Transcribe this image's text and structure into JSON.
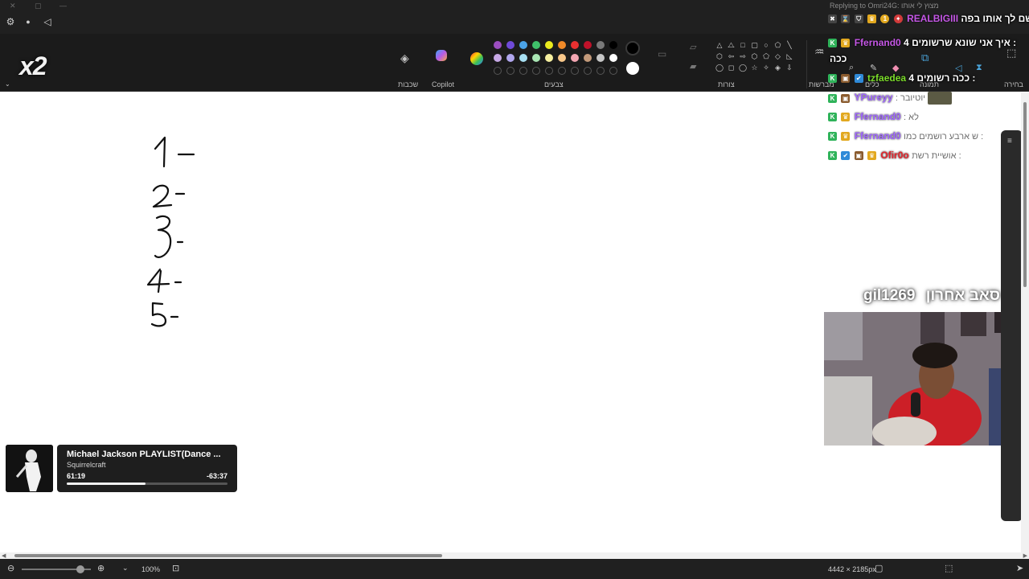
{
  "multiplier": "x2",
  "ribbon": {
    "groups": {
      "selection": "בחירה",
      "image": "תמונה",
      "tools": "כלים",
      "brushes": "מברשות",
      "shapes": "צורות",
      "colors": "צבעים",
      "copilot": "Copilot",
      "layers": "שכבות"
    },
    "palette": {
      "row1": [
        "#9c4ec0",
        "#6f4ad8",
        "#4ba3e8",
        "#3fbf6a",
        "#eaea1e",
        "#f08a28",
        "#e83030",
        "#c0122a",
        "#7a7a7a",
        "#000000"
      ],
      "row2": [
        "#c7a9e6",
        "#b0a6ee",
        "#a7dff2",
        "#a9e6b4",
        "#f6f0a0",
        "#f8c78a",
        "#f3a6b2",
        "#c39a7a",
        "#c6c6c6",
        "#ffffff"
      ],
      "primary": "#000000",
      "secondary": "#ffffff"
    }
  },
  "chat": {
    "reply_context": "Replying to Omri24G: מצוץ לי אותו",
    "top_message": {
      "user": "REALBIGIII",
      "text": "שם לך אותו בפה:"
    },
    "messages": [
      {
        "user": "Ffernand0",
        "text": "איך אני שונא שרשומים 4 :",
        "extra": "ככה",
        "color": "pink"
      },
      {
        "user": "tzfaedea",
        "text": "ככה רשומים 4 :",
        "color": "green"
      },
      {
        "user": "YPureyy",
        "text": ": יוטיובר",
        "color": "purple"
      },
      {
        "user": "Ffernand0",
        "text": ": לא",
        "color": "purple"
      },
      {
        "user": "Ffernand0",
        "text": "ש ארבע רושמים כמו :",
        "color": "purple"
      },
      {
        "user": "Ofir0o",
        "text": "אושיית רשת :",
        "color": "red"
      }
    ]
  },
  "follower_banner": {
    "user": "gil1269",
    "label": "סאב אחרון"
  },
  "canvas_labels": [
    "1",
    "2",
    "3",
    "4",
    "5"
  ],
  "player": {
    "title": "Michael Jackson PLAYLIST(Dance ...",
    "artist": "Squirrelcraft",
    "elapsed": "61:19",
    "remaining": "-63:37",
    "progress": 0.49
  },
  "status": {
    "zoom": "100%",
    "dimensions": "4442 × 2185px"
  }
}
